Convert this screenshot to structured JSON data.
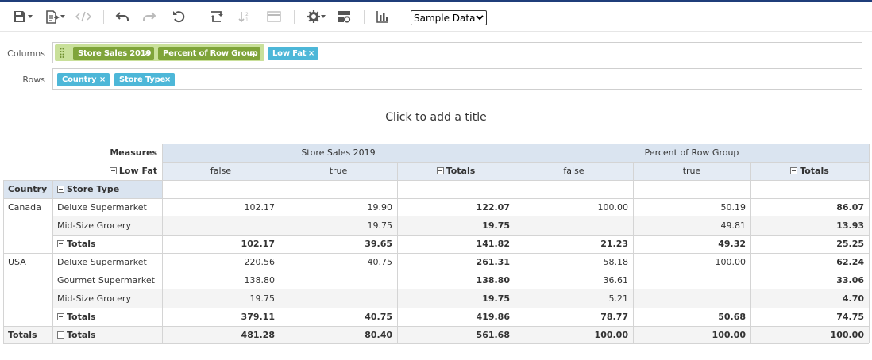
{
  "toolbar": {
    "icons": [
      "save-icon",
      "export-icon",
      "embed-code-icon",
      "undo-icon",
      "redo-icon",
      "reset-icon",
      "swap-axes-icon",
      "sort-icon",
      "format-icon",
      "settings-icon",
      "calculated-fields-icon",
      "chart-icon"
    ],
    "dataset_select": "Sample Data"
  },
  "colors": {
    "green_chip": "#7fa43a",
    "blue_chip": "#4db7d8",
    "header_bg": "#dae4f0"
  },
  "columns": {
    "label": "Columns",
    "chips": [
      {
        "label": "Store Sales 2019",
        "remove": "×"
      },
      {
        "label": "Percent of Row Group",
        "remove": "×"
      },
      {
        "label": "Low Fat",
        "remove": "×"
      }
    ]
  },
  "rows": {
    "label": "Rows",
    "chips": [
      {
        "label": "Country",
        "remove": "×"
      },
      {
        "label": "Store Type",
        "remove": "×"
      }
    ]
  },
  "title": "Click to add a title",
  "grid": {
    "measures_label": "Measures",
    "lowfat_label": "Low Fat",
    "country_label": "Country",
    "storetype_label": "Store Type",
    "measure_groups": [
      "Store Sales 2019",
      "Percent of Row Group"
    ],
    "subheaders": [
      "false",
      "true",
      "Totals",
      "false",
      "true",
      "Totals"
    ],
    "rows": [
      {
        "country": "Canada",
        "type": "Deluxe Supermarket",
        "values": [
          "102.17",
          "19.90",
          "122.07",
          "100.00",
          "50.19",
          "86.07"
        ]
      },
      {
        "country": "",
        "type": "Mid-Size Grocery",
        "values": [
          "",
          "19.75",
          "19.75",
          "",
          "49.81",
          "13.93"
        ]
      },
      {
        "country": "",
        "type": "Totals",
        "values": [
          "102.17",
          "39.65",
          "141.82",
          "21.23",
          "49.32",
          "25.25"
        ]
      },
      {
        "country": "USA",
        "type": "Deluxe Supermarket",
        "values": [
          "220.56",
          "40.75",
          "261.31",
          "58.18",
          "100.00",
          "62.24"
        ]
      },
      {
        "country": "",
        "type": "Gourmet Supermarket",
        "values": [
          "138.80",
          "",
          "138.80",
          "36.61",
          "",
          "33.06"
        ]
      },
      {
        "country": "",
        "type": "Mid-Size Grocery",
        "values": [
          "19.75",
          "",
          "19.75",
          "5.21",
          "",
          "4.70"
        ]
      },
      {
        "country": "",
        "type": "Totals",
        "values": [
          "379.11",
          "40.75",
          "419.86",
          "78.77",
          "50.68",
          "74.75"
        ]
      },
      {
        "country": "Totals",
        "type": "Totals",
        "values": [
          "481.28",
          "80.40",
          "561.68",
          "100.00",
          "100.00",
          "100.00"
        ]
      }
    ]
  }
}
